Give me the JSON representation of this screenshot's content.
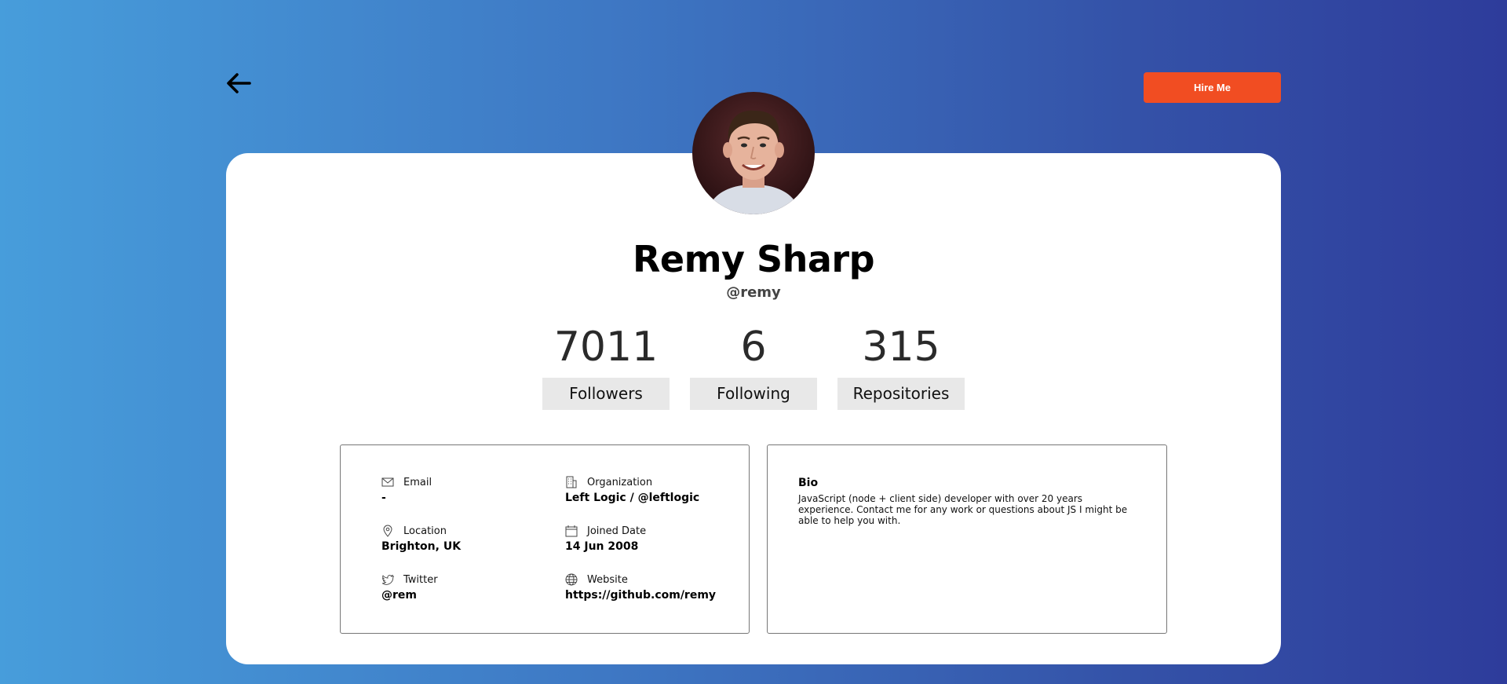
{
  "header": {
    "back_icon": "arrow-left-icon",
    "hire_label": "Hire Me",
    "hire_color": "#f14d22"
  },
  "profile": {
    "name": "Remy Sharp",
    "handle": "@remy",
    "avatar_icon": "avatar"
  },
  "stats": [
    {
      "value": "7011",
      "label": "Followers"
    },
    {
      "value": "6",
      "label": "Following"
    },
    {
      "value": "315",
      "label": "Repositories"
    }
  ],
  "details": {
    "email": {
      "label": "Email",
      "value": "-",
      "icon": "mail-icon"
    },
    "organization": {
      "label": "Organization",
      "value": "Left Logic / @leftlogic",
      "icon": "building-icon"
    },
    "location": {
      "label": "Location",
      "value": "Brighton, UK",
      "icon": "location-pin-icon"
    },
    "joined": {
      "label": "Joined Date",
      "value": "14 Jun 2008",
      "icon": "calendar-icon"
    },
    "twitter": {
      "label": "Twitter",
      "value": "@rem",
      "icon": "twitter-icon"
    },
    "website": {
      "label": "Website",
      "value": "https://github.com/remy",
      "icon": "globe-icon"
    }
  },
  "bio": {
    "title": "Bio",
    "text": "JavaScript (node + client side) developer with over 20 years experience. Contact me for any work or questions about JS I might be able to help you with."
  },
  "colors": {
    "gradient_start": "#479ddb",
    "gradient_end": "#2e3c9b"
  }
}
